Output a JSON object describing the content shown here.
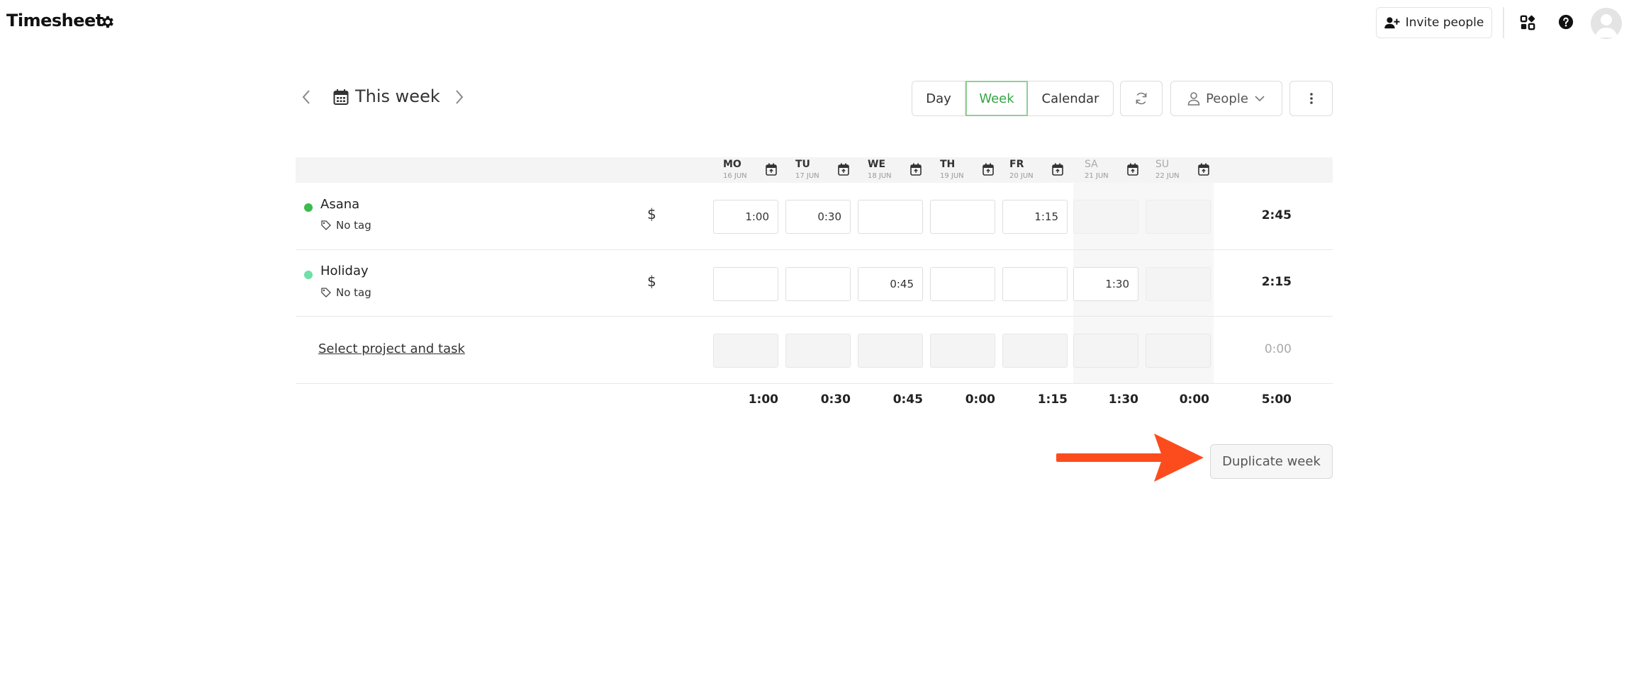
{
  "header": {
    "title": "Timesheet",
    "invite_label": "Invite people"
  },
  "toolbar": {
    "week_label": "This week",
    "view_tabs": [
      "Day",
      "Week",
      "Calendar"
    ],
    "active_view": "Week",
    "people_label": "People"
  },
  "days": [
    {
      "abbr": "MO",
      "date": "16 JUN",
      "total": "1:00",
      "weekend": false
    },
    {
      "abbr": "TU",
      "date": "17 JUN",
      "total": "0:30",
      "weekend": false
    },
    {
      "abbr": "WE",
      "date": "18 JUN",
      "total": "0:45",
      "weekend": false
    },
    {
      "abbr": "TH",
      "date": "19 JUN",
      "total": "0:00",
      "weekend": false
    },
    {
      "abbr": "FR",
      "date": "20 JUN",
      "total": "1:15",
      "weekend": false
    },
    {
      "abbr": "SA",
      "date": "21 JUN",
      "total": "1:30",
      "weekend": true
    },
    {
      "abbr": "SU",
      "date": "22 JUN",
      "total": "0:00",
      "weekend": true
    }
  ],
  "rows": [
    {
      "project": "Asana",
      "color": "#3dbb4c",
      "tag": "No tag",
      "billable": "$",
      "cells": [
        "1:00",
        "0:30",
        "",
        "",
        "1:15",
        "",
        ""
      ],
      "total": "2:45"
    },
    {
      "project": "Holiday",
      "color": "#6fe0a6",
      "tag": "No tag",
      "billable": "$",
      "cells": [
        "",
        "",
        "0:45",
        "",
        "",
        "1:30",
        ""
      ],
      "total": "2:15"
    }
  ],
  "empty_row": {
    "label": "Select project and task",
    "total": "0:00"
  },
  "grand_total": "5:00",
  "duplicate_label": "Duplicate week",
  "colors": {
    "accent": "#37a444",
    "arrow": "#fc4c1e"
  }
}
